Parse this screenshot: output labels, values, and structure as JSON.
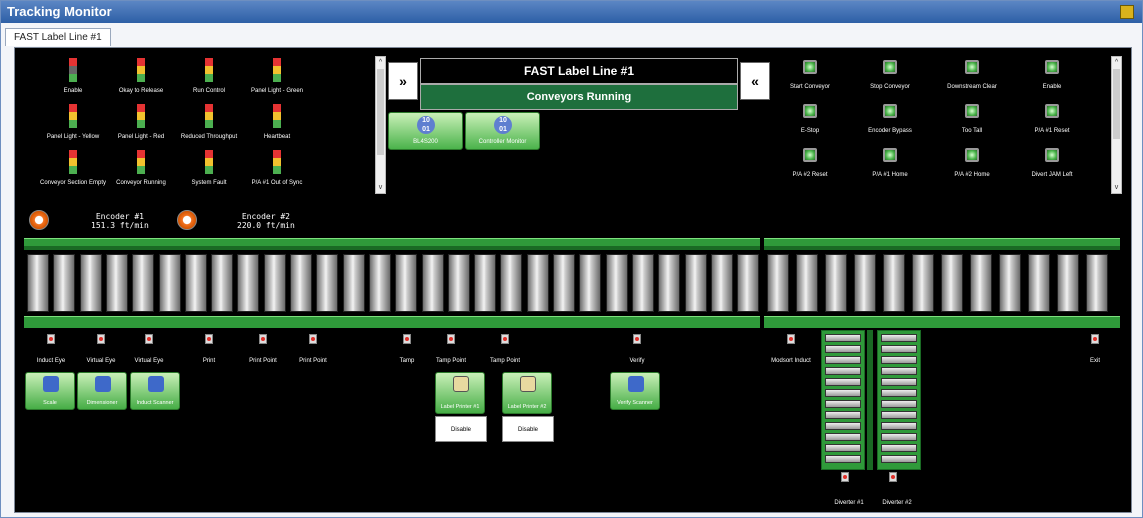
{
  "window": {
    "title": "Tracking Monitor",
    "tab": "FAST Label Line #1"
  },
  "header": {
    "line_title": "FAST Label Line #1",
    "status": "Conveyors Running",
    "nav_left": "»",
    "nav_right": "«"
  },
  "indicators": [
    {
      "label": "Enable"
    },
    {
      "label": "Okay to Release"
    },
    {
      "label": "Run Control"
    },
    {
      "label": "Panel Light - Green"
    },
    {
      "label": "Panel Light - Yellow"
    },
    {
      "label": "Panel Light - Red"
    },
    {
      "label": "Reduced Throughput"
    },
    {
      "label": "Heartbeat"
    },
    {
      "label": "Conveyor Section Empty"
    },
    {
      "label": "Conveyor Running"
    },
    {
      "label": "System Fault"
    },
    {
      "label": "P/A #1 Out of Sync"
    }
  ],
  "controllers": [
    {
      "label": "BL4S200"
    },
    {
      "label": "Controller Monitor"
    }
  ],
  "buttons": [
    {
      "label": "Start Conveyor"
    },
    {
      "label": "Stop Conveyor"
    },
    {
      "label": "Downstream Clear"
    },
    {
      "label": "Enable"
    },
    {
      "label": "E-Stop"
    },
    {
      "label": "Encoder Bypass"
    },
    {
      "label": "Too Tall"
    },
    {
      "label": "P/A #1 Reset"
    },
    {
      "label": "P/A #2 Reset"
    },
    {
      "label": "P/A #1 Home"
    },
    {
      "label": "P/A #2 Home"
    },
    {
      "label": "Divert JAM Left"
    }
  ],
  "encoders": [
    {
      "name": "Encoder #1",
      "speed": "151.3 ft/min"
    },
    {
      "name": "Encoder #2",
      "speed": "220.0 ft/min"
    }
  ],
  "sensors": [
    {
      "label": "Induct Eye"
    },
    {
      "label": "Virtual Eye"
    },
    {
      "label": "Virtual Eye"
    },
    {
      "label": "Print"
    },
    {
      "label": "Print Point"
    },
    {
      "label": "Print Point"
    },
    {
      "label": "Tamp"
    },
    {
      "label": "Tamp Point"
    },
    {
      "label": "Tamp Point"
    },
    {
      "label": "Verify"
    },
    {
      "label": "Modsort Induct"
    },
    {
      "label": "Exit"
    }
  ],
  "devices": [
    {
      "label": "Scale"
    },
    {
      "label": "Dimensioner"
    },
    {
      "label": "Induct Scanner"
    },
    {
      "label": "Label Printer #1"
    },
    {
      "label": "Label Printer #2"
    },
    {
      "label": "Verify Scanner"
    }
  ],
  "disable_label": "Disable",
  "diverters": [
    {
      "label": "Diverter #1"
    },
    {
      "label": "Diverter #2"
    }
  ],
  "colors": {
    "status_green": "#1e6f3d",
    "button_green": "#49b349",
    "title_blue": "#2d5fa6"
  }
}
